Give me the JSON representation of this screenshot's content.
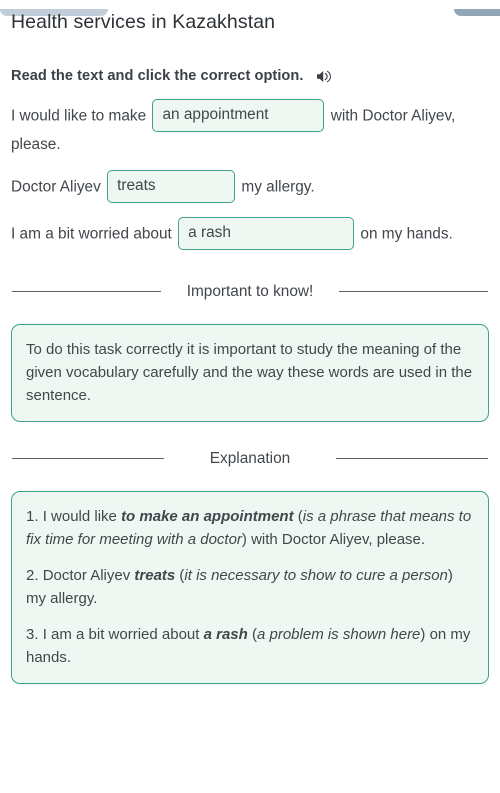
{
  "window": {
    "chrome_left": "tab-strip-left",
    "chrome_right": "tab-strip-right"
  },
  "header": {
    "title": "Health services in Kazakhstan"
  },
  "instruction": {
    "text": "Read the text and click the correct option.",
    "audio_icon": "speaker-icon"
  },
  "exercise": {
    "sentences": [
      {
        "before": "I would like to make",
        "answer": "an appointment",
        "after": "with Doctor Aliyev, please."
      },
      {
        "before": "Doctor Aliyev",
        "answer": "treats",
        "after": "my allergy."
      },
      {
        "before": "I am a bit worried about",
        "answer": "a rash",
        "after": "on my hands."
      }
    ]
  },
  "important": {
    "heading": "Important to know!",
    "body": "To do this task correctly it is important to study the meaning of the given vocabulary carefully and the way these words are used in the sentence."
  },
  "explanation": {
    "heading": "Explanation",
    "items": [
      {
        "num": "1. ",
        "lead": "I would like ",
        "key": "to make an appointment",
        "paren_open": " (",
        "note": "is a phrase that means to fix time for meeting with a doctor",
        "paren_close": ") ",
        "tail": "with Doctor Aliyev, please."
      },
      {
        "num": "2. ",
        "lead": "Doctor Aliyev ",
        "key": "treats",
        "paren_open": " (",
        "note": "it is necessary to show to cure a person",
        "paren_close": ") ",
        "tail": "my allergy."
      },
      {
        "num": "3. ",
        "lead": "I am a bit worried about ",
        "key": "a rash",
        "paren_open": " (",
        "note": "a problem is shown here",
        "paren_close": ") ",
        "tail": "on my hands."
      }
    ]
  },
  "colors": {
    "accent_border": "#3fa08d",
    "accent_fill": "#eff7f2",
    "text": "#42474c",
    "rule": "#5b6166",
    "chrome": "#93a6b8"
  }
}
